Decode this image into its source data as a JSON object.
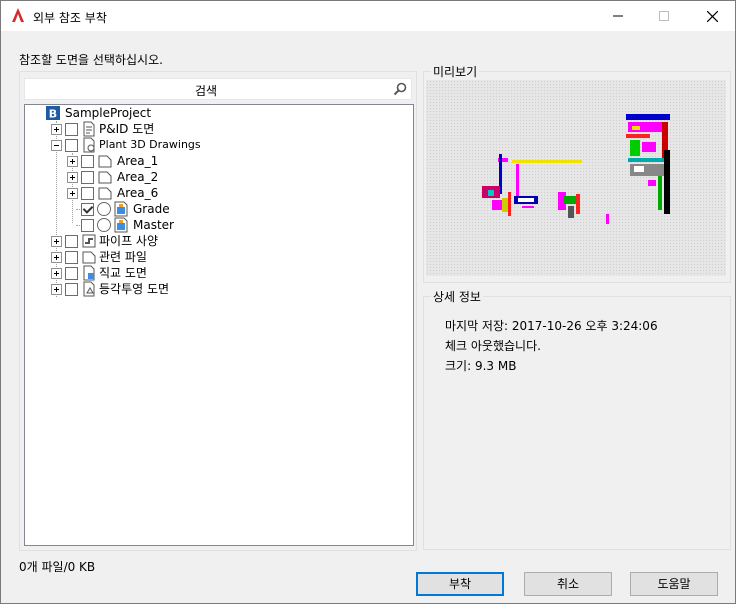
{
  "window": {
    "title": "외부 참조 부착",
    "minimize_icon": "minimize-icon",
    "maximize_icon": "maximize-icon",
    "close_icon": "close-icon"
  },
  "instruction": "참조할 도면을 선택하십시오.",
  "search": {
    "label": "검색",
    "icon": "search-icon"
  },
  "tree": {
    "root": {
      "label": "SampleProject",
      "icon": "project-icon"
    },
    "items": [
      {
        "label": "P&ID 도면",
        "icon": "pid-drawing-icon",
        "expanded": false
      },
      {
        "label": "Plant 3D Drawings",
        "icon": "plant3d-icon",
        "expanded": true
      },
      {
        "label": "Area_1",
        "icon": "folder-icon",
        "expanded": false
      },
      {
        "label": "Area_2",
        "icon": "folder-icon",
        "expanded": false
      },
      {
        "label": "Area_6",
        "icon": "folder-icon",
        "expanded": false
      },
      {
        "label": "Grade",
        "icon": "drawing-file-icon",
        "checked": true
      },
      {
        "label": "Master",
        "icon": "drawing-file-icon",
        "checked": false
      },
      {
        "label": "파이프 사양",
        "icon": "pipe-spec-icon",
        "expanded": false
      },
      {
        "label": "관련 파일",
        "icon": "folder-icon",
        "expanded": false
      },
      {
        "label": "직교 도면",
        "icon": "ortho-drawing-icon",
        "expanded": false
      },
      {
        "label": "등각투영 도면",
        "icon": "iso-drawing-icon",
        "expanded": false
      }
    ]
  },
  "status": "0개 파일/0 KB",
  "preview": {
    "label": "미리보기"
  },
  "details": {
    "label": "상세 정보",
    "last_saved": "마지막 저장: 2017-10-26 오후 3:24:06",
    "checkout": "체크 아웃했습니다.",
    "size": "크기: 9.3 MB"
  },
  "buttons": {
    "attach": "부착",
    "cancel": "취소",
    "help": "도움말"
  },
  "colors": {
    "accent": "#0078d7",
    "autocad_red": "#d52a2a",
    "tree_border": "#828790"
  }
}
